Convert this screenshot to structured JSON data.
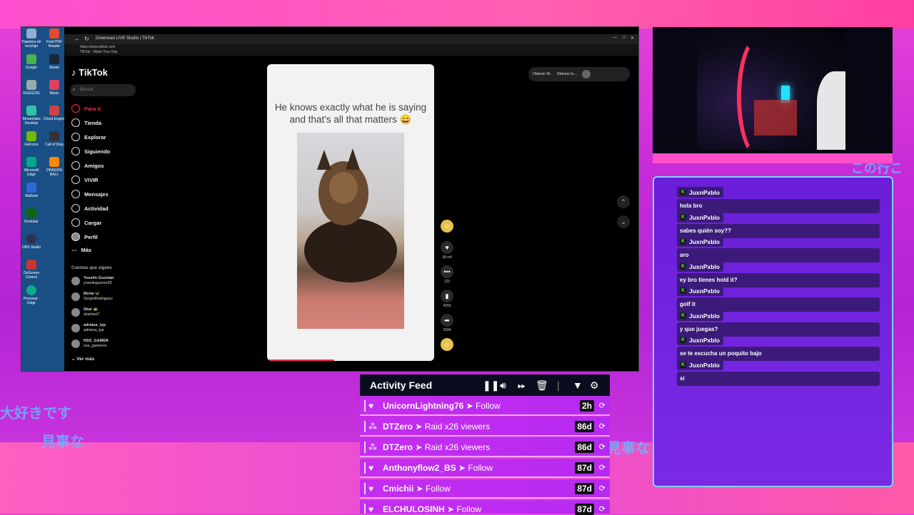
{
  "browser": {
    "tab_title": "Download LIVE Studio | TikTok",
    "url": "https://www.tiktok.com",
    "page_title": "TikTok - Make Your Day"
  },
  "desktop_icons": [
    "Papelera de reciclaje",
    "Foxit PDF Reader",
    "Google",
    "Steam",
    "SIGGGDG",
    "Music",
    "Streamlabs Desktop",
    "Cheat Engine",
    "GeForce",
    "Call of Duty",
    "Microsoft Edge",
    "DRAGON BALL",
    "Mullvad",
    "Rockstar",
    "OBS Studio",
    "OnScreen Control",
    "Personal - Edge"
  ],
  "tiktok": {
    "logo": "TikTok",
    "search_placeholder": "Buscar",
    "nav": [
      "Para ti",
      "Tienda",
      "Explorar",
      "Siguiendo",
      "Amigos",
      "VIVIR",
      "Mensajes",
      "Actividad",
      "Cargar",
      "Perfil",
      "Más"
    ],
    "following_header": "Cuentas que sigues",
    "following": [
      {
        "name": "Yoselin Guzmán",
        "handle": "yoselinguzmn25"
      },
      {
        "name": "Mvria 🦋",
        "handle": "SergioRodriguez"
      },
      {
        "name": "Skar 🐢",
        "handle": "skarleet7"
      },
      {
        "name": "adriana_typ",
        "handle": "adriana_typ"
      },
      {
        "name": "NSS_GAMER",
        "handle": "nss_gamerxx"
      }
    ],
    "see_more": "Ver más",
    "video_caption": "He knows exactly what he is saying and that's all that matters 😄",
    "counts": {
      "likes": "38 mil",
      "comments": "123",
      "saves": "4256",
      "shares": "2694"
    },
    "top_buttons": [
      "Obtener M...",
      "Obtener la ..."
    ]
  },
  "chat": [
    {
      "user": "JuxnPxblo",
      "text": "hola bro"
    },
    {
      "user": "JuxnPxblo",
      "text": "sabes quién soy??"
    },
    {
      "user": "JuxnPxblo",
      "text": "aro"
    },
    {
      "user": "JuxnPxblo",
      "text": "ey bro tienes hold it?"
    },
    {
      "user": "JuxnPxblo",
      "text": "golf it"
    },
    {
      "user": "JuxnPxblo",
      "text": "y que juegas?"
    },
    {
      "user": "JuxnPxblo",
      "text": "se te escucha un poquito bajo"
    },
    {
      "user": "JuxnPxblo",
      "text": "si"
    }
  ],
  "activity_feed": {
    "title": "Activity Feed",
    "rows": [
      {
        "icon": "heart-icon",
        "user": "UnicornLightning76",
        "action": " ➤ Follow",
        "age": "2h"
      },
      {
        "icon": "raid-icon",
        "user": "DTZero",
        "action": " ➤ Raid x26 viewers",
        "age": "86d"
      },
      {
        "icon": "raid-icon",
        "user": "DTZero",
        "action": " ➤ Raid x26 viewers",
        "age": "86d"
      },
      {
        "icon": "heart-icon",
        "user": "Anthonyflow2_BS",
        "action": " ➤ Follow",
        "age": "87d"
      },
      {
        "icon": "heart-icon",
        "user": "Cmichii",
        "action": " ➤ Follow",
        "age": "87d"
      },
      {
        "icon": "heart-icon",
        "user": "ELCHULOSINH",
        "action": " ➤ Follow",
        "age": "87d"
      }
    ]
  },
  "overlay_text": [
    "大好きです",
    "見事な",
    "見事な",
    "この行こ"
  ]
}
